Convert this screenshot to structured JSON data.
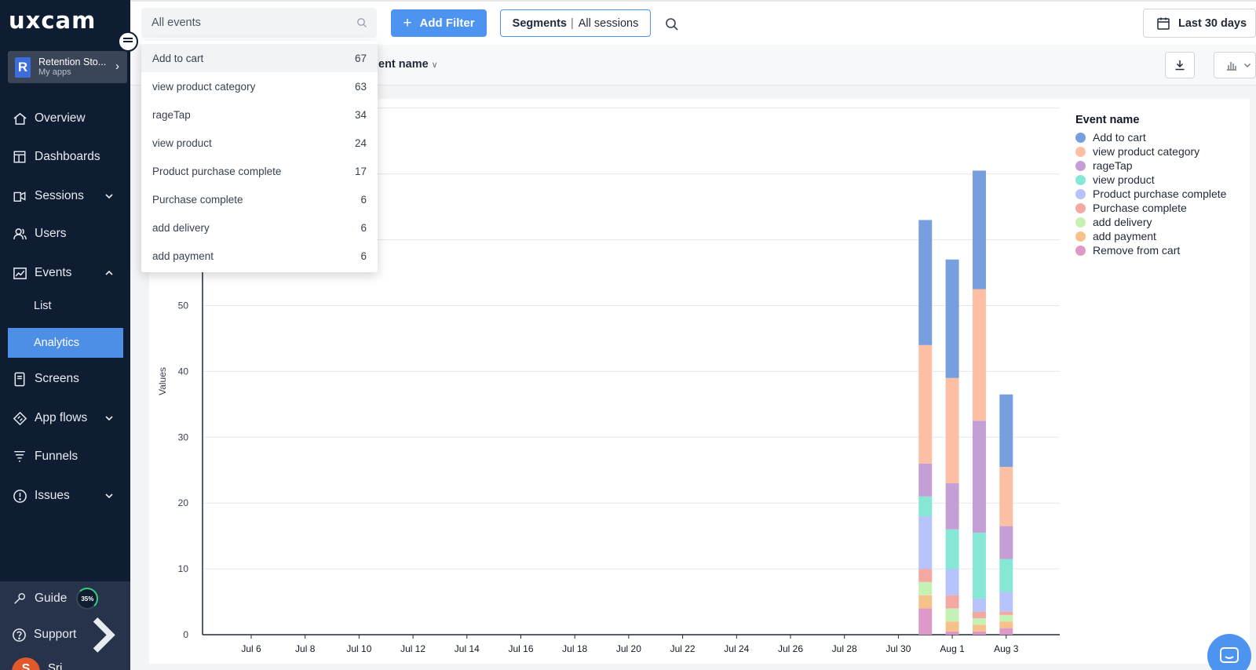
{
  "sidebar": {
    "logo": "uxcam",
    "app": {
      "initial": "R",
      "name": "Retention Sto...",
      "sub": "My apps"
    },
    "nav": {
      "overview": "Overview",
      "dashboards": "Dashboards",
      "sessions": "Sessions",
      "users": "Users",
      "events": "Events",
      "events_list": "List",
      "events_analytics": "Analytics",
      "screens": "Screens",
      "app_flows": "App flows",
      "funnels": "Funnels",
      "issues": "Issues"
    },
    "guide": {
      "label": "Guide",
      "progress": "35%"
    },
    "support": "Support",
    "user": {
      "initial": "S",
      "name": "Sri..."
    }
  },
  "topbar": {
    "search_value": "All events",
    "add_filter": "Add Filter",
    "segments_label": "Segments",
    "segments_sep": "|",
    "segments_value": "All sessions",
    "date_range": "Last 30 days"
  },
  "subheader": {
    "group_by": "ent name"
  },
  "dropdown": {
    "items": [
      {
        "label": "Add to cart",
        "count": "67"
      },
      {
        "label": "view product category",
        "count": "63"
      },
      {
        "label": "rageTap",
        "count": "34"
      },
      {
        "label": "view product",
        "count": "24"
      },
      {
        "label": "Product purchase complete",
        "count": "17"
      },
      {
        "label": "Purchase complete",
        "count": "6"
      },
      {
        "label": "add delivery",
        "count": "6"
      },
      {
        "label": "add payment",
        "count": "6"
      }
    ]
  },
  "colors": {
    "sidebar_bg": "#0f1d33",
    "accent": "#4d93f0"
  },
  "chart_data": {
    "type": "bar",
    "stacked": true,
    "ylabel": "Values",
    "ylim": [
      0,
      80
    ],
    "yticks": [
      0,
      10,
      20,
      30,
      40,
      50
    ],
    "grid": true,
    "legend_title": "Event name",
    "legend_position": "right",
    "x_tick_labels": [
      "Jul 6",
      "Jul 8",
      "Jul 10",
      "Jul 12",
      "Jul 14",
      "Jul 16",
      "Jul 18",
      "Jul 20",
      "Jul 22",
      "Jul 24",
      "Jul 26",
      "Jul 28",
      "Jul 30",
      "Aug 1",
      "Aug 3"
    ],
    "categories": [
      "Jul 31",
      "Aug 1",
      "Aug 2",
      "Aug 3"
    ],
    "series": [
      {
        "name": "Remove from cart",
        "color": "#dd9ac8",
        "values": [
          4,
          0.5,
          0.5,
          1
        ]
      },
      {
        "name": "add payment",
        "color": "#f6c28a",
        "values": [
          2,
          1.5,
          1,
          1
        ]
      },
      {
        "name": "add delivery",
        "color": "#c6f1b4",
        "values": [
          2,
          2,
          1,
          1
        ]
      },
      {
        "name": "Purchase complete",
        "color": "#f4a8a2",
        "values": [
          2,
          2,
          1,
          0.5
        ]
      },
      {
        "name": "Product purchase complete",
        "color": "#b6c4fb",
        "values": [
          8,
          4,
          2,
          3
        ]
      },
      {
        "name": "view product",
        "color": "#86e8d4",
        "values": [
          3,
          6,
          10,
          5
        ]
      },
      {
        "name": "rageTap",
        "color": "#c39fd6",
        "values": [
          5,
          7,
          17,
          5
        ]
      },
      {
        "name": "view product category",
        "color": "#fdbfa3",
        "values": [
          18,
          16,
          20,
          9
        ]
      },
      {
        "name": "Add to cart",
        "color": "#779fdd",
        "values": [
          19,
          18,
          18,
          11
        ]
      }
    ],
    "legend_order": [
      "Add to cart",
      "view product category",
      "rageTap",
      "view product",
      "Product purchase complete",
      "Purchase complete",
      "add delivery",
      "add payment",
      "Remove from cart"
    ]
  }
}
